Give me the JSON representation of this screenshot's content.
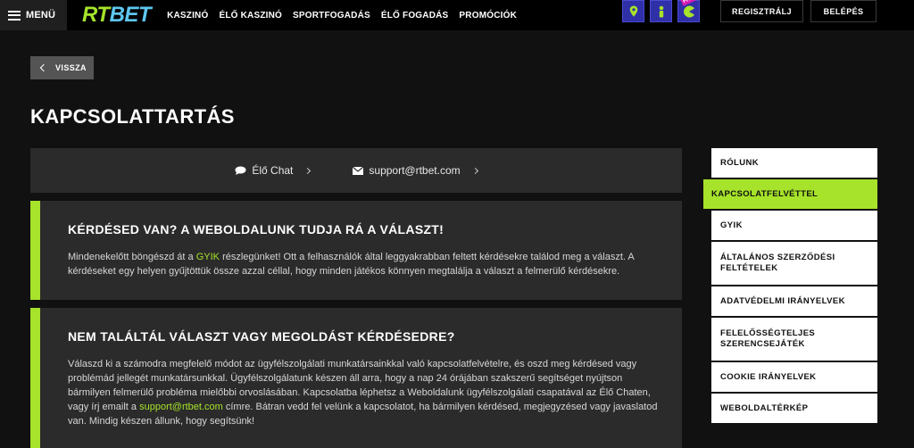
{
  "header": {
    "menu_label": "MENÜ",
    "logo_rt": "RT",
    "logo_bet": "BET",
    "nav": [
      "KASZINÓ",
      "ÉLŐ KASZINÓ",
      "SPORTFOGADÁS",
      "ÉLŐ FOGADÁS",
      "PROMÓCIÓK"
    ],
    "quick_icons": [
      "map-pin-icon",
      "person-icon",
      "pacman-icon"
    ],
    "register_label": "REGISZTRÁLJ",
    "login_label": "BELÉPÉS"
  },
  "back_label": "VISSZA",
  "page_title": "KAPCSOLATTARTÁS",
  "contact": {
    "chat_label": "Élő Chat",
    "email_label": "support@rtbet.com"
  },
  "cards": [
    {
      "title": "KÉRDÉSED VAN? A WEBOLDALUNK TUDJA RÁ A VÁLASZT!",
      "text_before": "Mindenekelőtt böngészd át a ",
      "link": "GYIK",
      "text_after": " részlegünket! Ott a felhasználók által leggyakrabban feltett kérdésekre találod meg a választ. A kérdéseket egy helyen gyűjtöttük össze azzal céllal, hogy minden játékos könnyen megtalálja a választ a felmerülő kérdésekre."
    },
    {
      "title": "NEM TALÁLTÁL VÁLASZT VAGY MEGOLDÁST KÉRDÉSEDRE?",
      "text_before": "Válaszd ki a számodra megfelelő módot az ügyfélszolgálati munkatársainkkal való kapcsolatfelvételre, és oszd meg kérdésed vagy problémád jellegét munkatársunkkal. Ügyfélszolgálatunk készen áll arra, hogy a nap 24 órájában szakszerű segítséget nyújtson bármilyen felmerülő probléma mielőbbi orvoslásában. Kapcsolatba léphetsz a Weboldalunk ügyfélszolgálati csapatával az Élő Chaten, vagy írj emailt a ",
      "link": "support@rtbet.com",
      "text_after": " címre. Bátran vedd fel velünk a kapcsolatot, ha bármilyen kérdésed, megjegyzésed vagy javaslatod van. Mindig készen állunk, hogy segítsünk!"
    }
  ],
  "sidebar": [
    {
      "label": "RÓLUNK",
      "active": false
    },
    {
      "label": "KAPCSOLATFELVÉTTEL",
      "active": true
    },
    {
      "label": "GYIK",
      "active": false
    },
    {
      "label": "ÁLTALÁNOS SZERZŐDÉSI FELTÉTELEK",
      "active": false
    },
    {
      "label": "ADATVÉDELMI IRÁNYELVEK",
      "active": false
    },
    {
      "label": "FELELŐSSÉGTELJES SZERENCSEJÁTÉK",
      "active": false
    },
    {
      "label": "COOKIE IRÁNYELVEK",
      "active": false
    },
    {
      "label": "WEBOLDALTÉRKÉP",
      "active": false
    }
  ],
  "colors": {
    "accent": "#a6e32a",
    "logo_bet": "#5ec7f0",
    "icon_bg": "#2f2fa8"
  }
}
